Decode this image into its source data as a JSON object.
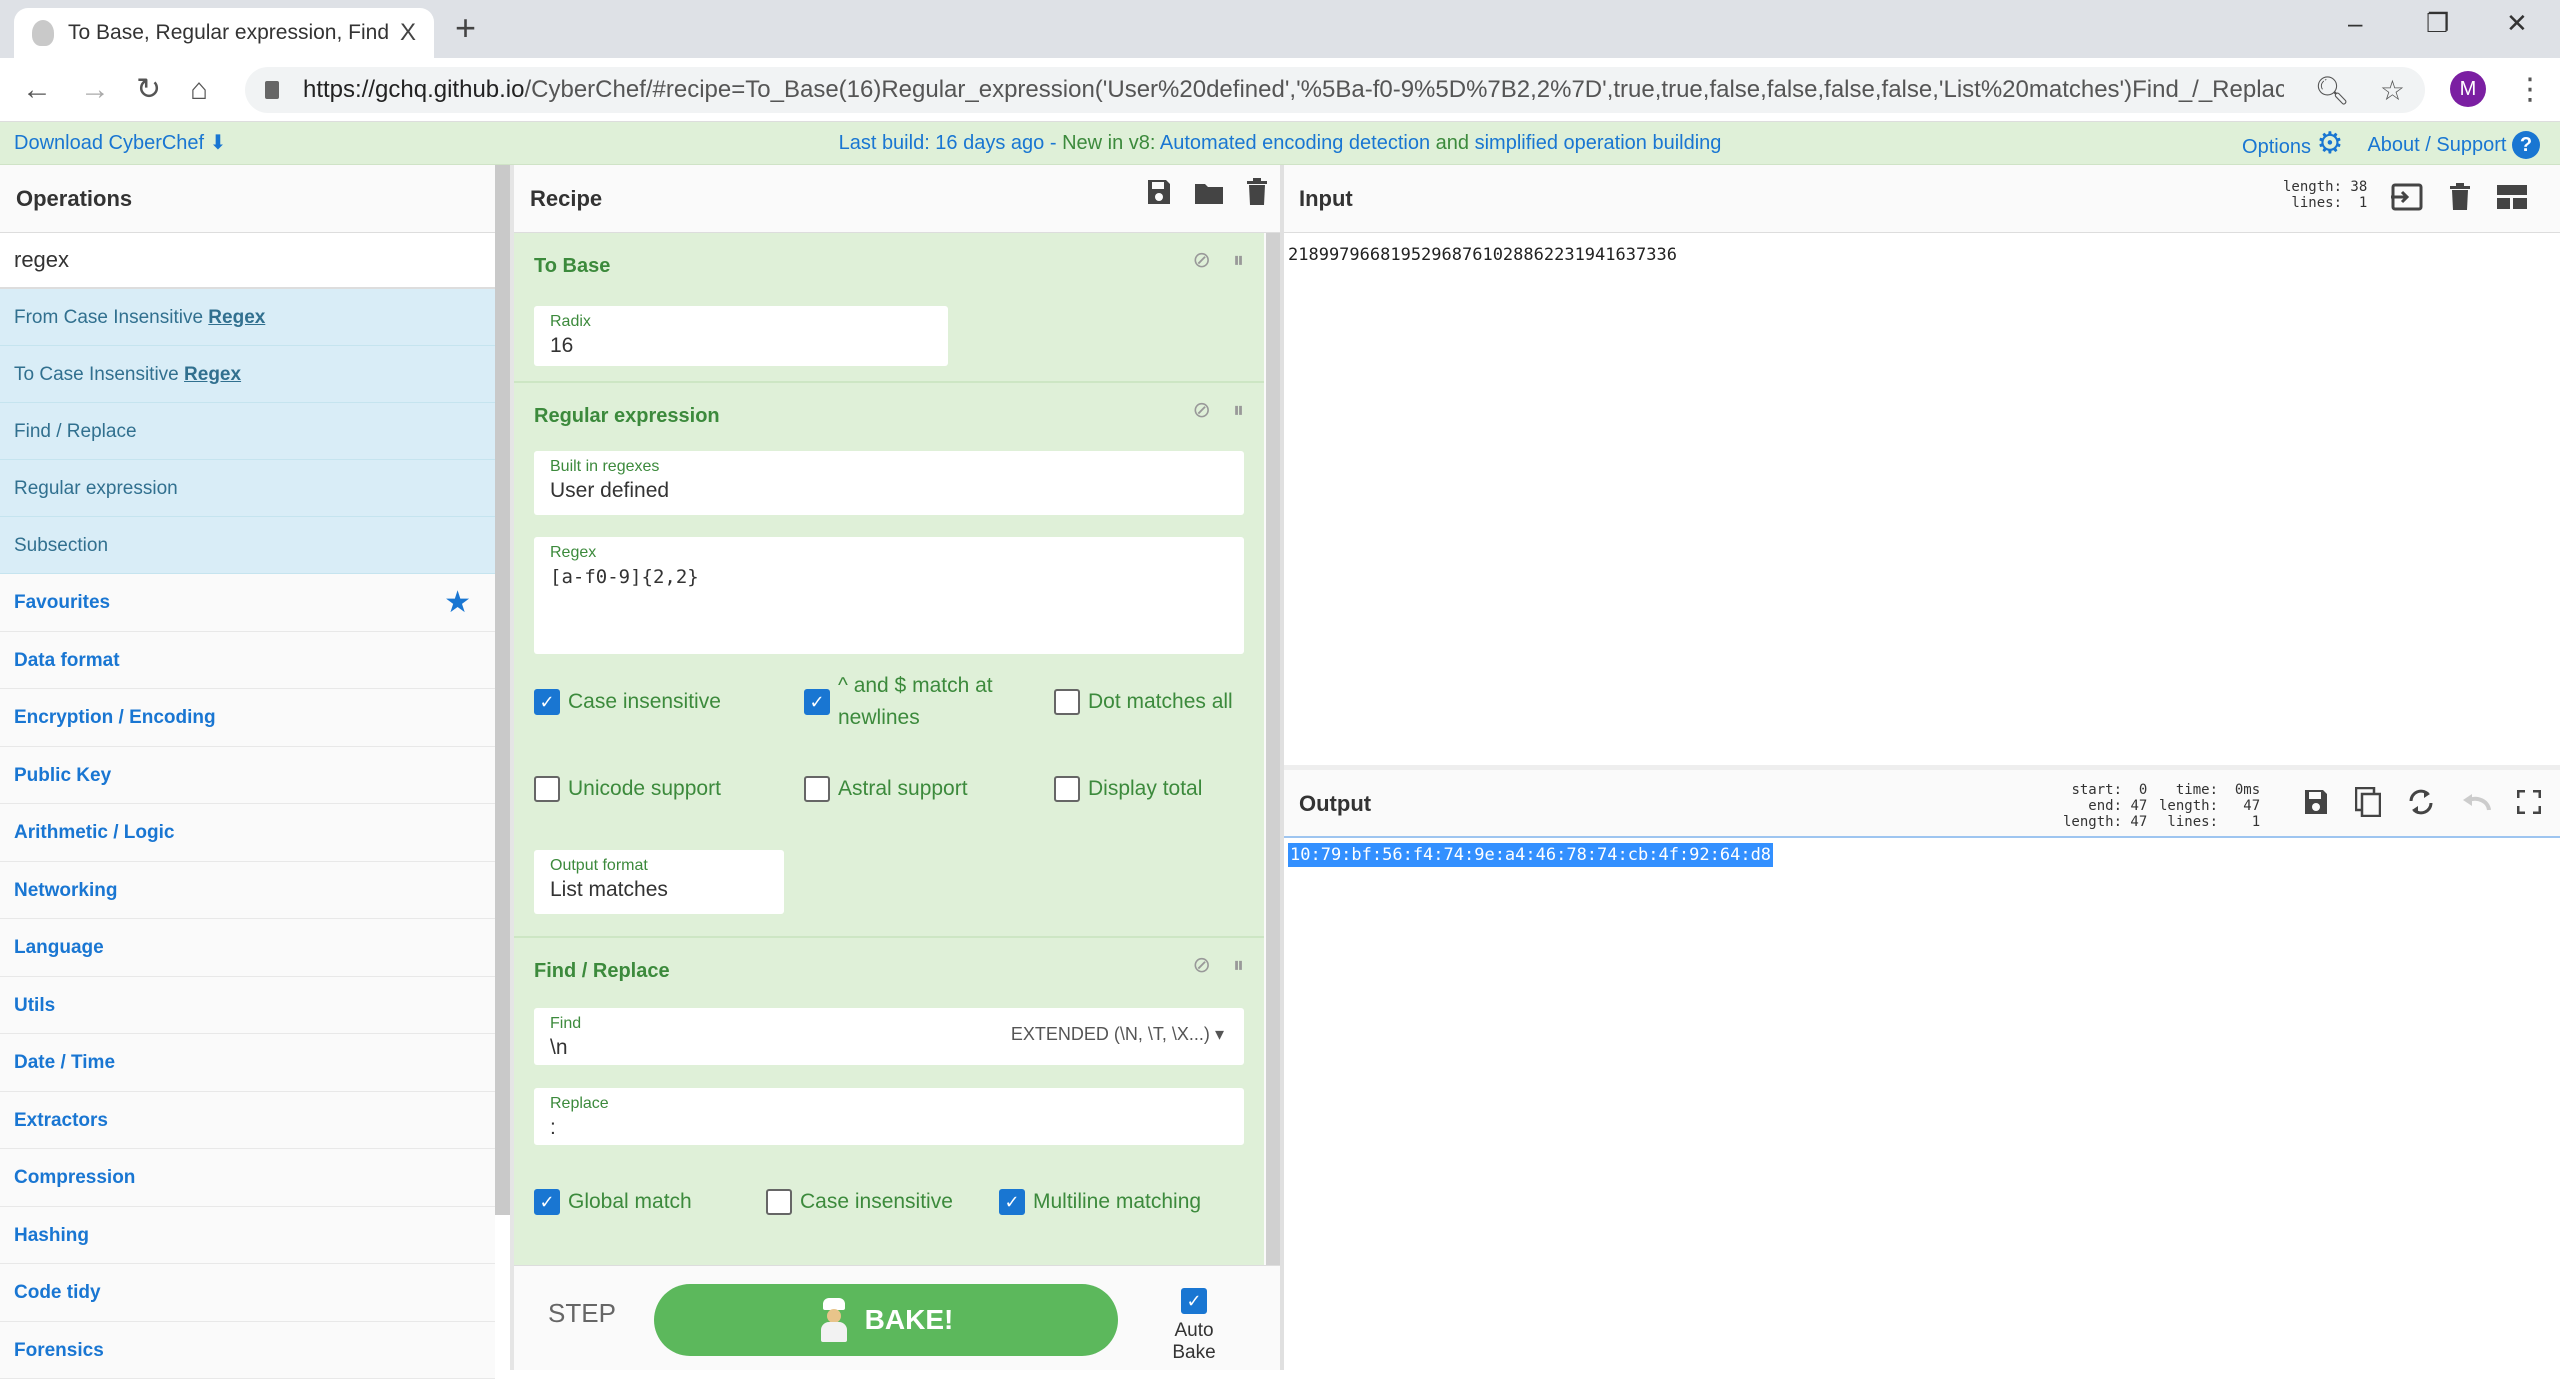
{
  "browser": {
    "tab_title": "To Base, Regular expression, Find",
    "tab_close": "X",
    "new_tab": "+",
    "url_host": "https://gchq.github.io",
    "url_path": "/CyberChef/#recipe=To_Base(16)Regular_expression('User%20defined','%5Ba-f0-9%5D%7B2,2%7D',true,true,false,false,false,false,'List%20matches')Find_/_Replace...",
    "avatar_letter": "M",
    "window_controls": {
      "minimize": "–",
      "maximize": "❐",
      "close": "✕"
    },
    "nav": {
      "back": "←",
      "forward": "→",
      "reload": "↻",
      "home": "⌂"
    },
    "icons": {
      "zoom": "🔍︎",
      "bookmark": "☆",
      "menu": "⋮"
    }
  },
  "banner": {
    "download": "Download CyberChef",
    "download_icon": "⬇",
    "build_prefix": "Last build: 16 days ago - ",
    "build_new": "New in v8: ",
    "build_part1": "Automated encoding detection ",
    "build_and": "and ",
    "build_part2": "simplified operation building",
    "options": "Options",
    "about": "About / Support",
    "about_icon": "?"
  },
  "operations": {
    "title": "Operations",
    "search_value": "regex",
    "results": [
      {
        "pre": "From Case Insensitive ",
        "match": "Regex"
      },
      {
        "pre": "To Case Insensitive ",
        "match": "Regex"
      },
      {
        "pre": "Find / Replace",
        "match": ""
      },
      {
        "pre": "Regular expression",
        "match": ""
      },
      {
        "pre": "Subsection",
        "match": ""
      }
    ],
    "categories": [
      "Favourites",
      "Data format",
      "Encryption / Encoding",
      "Public Key",
      "Arithmetic / Logic",
      "Networking",
      "Language",
      "Utils",
      "Date / Time",
      "Extractors",
      "Compression",
      "Hashing",
      "Code tidy",
      "Forensics"
    ]
  },
  "recipe": {
    "title": "Recipe",
    "ops": {
      "to_base": {
        "title": "To Base",
        "radix_label": "Radix",
        "radix_value": "16"
      },
      "regex": {
        "title": "Regular expression",
        "builtin_label": "Built in regexes",
        "builtin_value": "User defined",
        "regex_label": "Regex",
        "regex_value": "[a-f0-9]{2,2}",
        "checkboxes": [
          {
            "label": "Case insensitive",
            "checked": true
          },
          {
            "label": "^ and $ match at newlines",
            "checked": true
          },
          {
            "label": "Dot matches all",
            "checked": false
          },
          {
            "label": "Unicode support",
            "checked": false
          },
          {
            "label": "Astral support",
            "checked": false
          },
          {
            "label": "Display total",
            "checked": false
          }
        ],
        "output_label": "Output format",
        "output_value": "List matches"
      },
      "find_replace": {
        "title": "Find / Replace",
        "find_label": "Find",
        "find_value": "\\n",
        "find_mode": "EXTENDED (\\N, \\T, \\X...)",
        "replace_label": "Replace",
        "replace_value": ":",
        "checkboxes": [
          {
            "label": "Global match",
            "checked": true
          },
          {
            "label": "Case insensitive",
            "checked": false
          },
          {
            "label": "Multiline matching",
            "checked": true
          }
        ]
      }
    },
    "step_label": "STEP",
    "bake_label": "BAKE!",
    "autobake_label": "Auto Bake",
    "autobake_checked": true
  },
  "input": {
    "title": "Input",
    "stats": "length: 38\n lines:  1",
    "value": "21899796681952968761028862231941637336"
  },
  "output": {
    "title": "Output",
    "stats_left": "start:  0\n  end: 47\nlength: 47",
    "stats_right": " time:  0ms\nlength:   47\n lines:    1",
    "value": "10:79:bf:56:f4:74:9e:a4:46:78:74:cb:4f:92:64:d8"
  }
}
